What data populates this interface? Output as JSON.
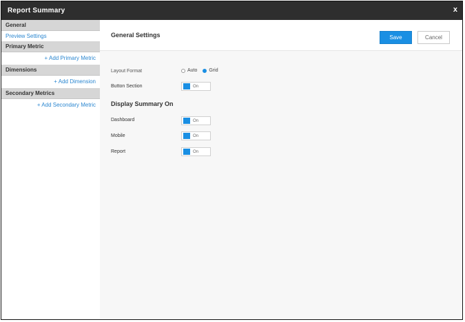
{
  "window": {
    "title": "Report Summary",
    "close_glyph": "x"
  },
  "sidebar": {
    "general": {
      "header": "General",
      "items": [
        {
          "label": "Preview Settings"
        }
      ]
    },
    "primary_metric": {
      "header": "Primary Metric",
      "add_label": "+ Add Primary Metric"
    },
    "dimensions": {
      "header": "Dimensions",
      "add_label": "+ Add Dimension"
    },
    "secondary_metrics": {
      "header": "Secondary Metrics",
      "add_label": "+ Add Secondary Metric"
    }
  },
  "main": {
    "heading": "General Settings",
    "save_label": "Save",
    "cancel_label": "Cancel",
    "layout_row": {
      "label": "Layout Format",
      "options": [
        {
          "label": "Auto",
          "selected": false
        },
        {
          "label": "Grid",
          "selected": true
        }
      ]
    },
    "button_section": {
      "label": "Button Section",
      "toggle_text": "On"
    },
    "display_summary": {
      "title": "Display Summary On",
      "rows": [
        {
          "label": "Dashboard",
          "toggle_text": "On"
        },
        {
          "label": "Mobile",
          "toggle_text": "On"
        },
        {
          "label": "Report",
          "toggle_text": "On"
        }
      ]
    }
  },
  "colors": {
    "accent": "#1a8fe3",
    "titlebar": "#2e2e2e",
    "sidebar_header": "#d6d6d6",
    "link": "#2a86d0"
  }
}
